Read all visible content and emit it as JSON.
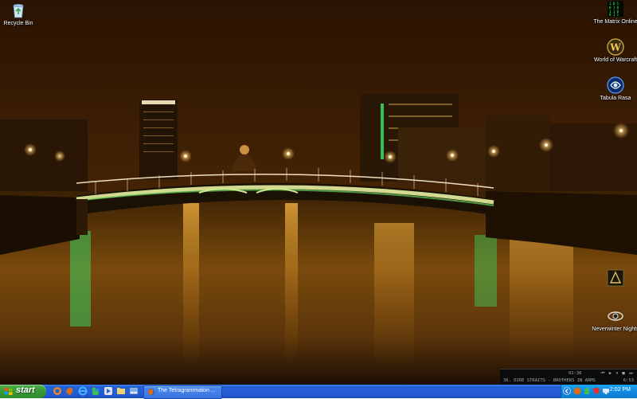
{
  "desktop_icons": [
    {
      "id": "recycle-bin",
      "label": "Recycle Bin",
      "icon": "recycle-bin-icon"
    },
    {
      "id": "matrix-online",
      "label": "The Matrix Online",
      "icon": "matrix-icon"
    },
    {
      "id": "wow",
      "label": "World of Warcraft",
      "icon": "warcraft-icon"
    },
    {
      "id": "tabula-rasa",
      "label": "Tabula Rasa",
      "icon": "tabula-rasa-icon"
    },
    {
      "id": "neverwinter",
      "label": "Neverwinter Nights",
      "icon": "neverwinter-icon"
    }
  ],
  "partial_icon": {
    "icon": "game-shortcut-icon"
  },
  "media_widget": {
    "time": "02:36",
    "controls": "⏮ ▶ ⏸ ■ ⏭",
    "track": "36. DIRE STRAITS - BROTHERS IN ARMS",
    "elapsed": "6:53"
  },
  "taskbar": {
    "start_label": "start",
    "quick_launch": [
      "browser-icon",
      "firefox-icon",
      "ie-icon",
      "messenger-icon",
      "media-icon",
      "folder-icon",
      "show-desktop-icon"
    ],
    "active_window": "The Tetragrammaton ...",
    "clock": "2:02 PM",
    "tray_icons": [
      "expand-tray-icon",
      "firefox-tray-icon",
      "messenger-tray-icon",
      "shield-tray-icon",
      "network-tray-icon",
      "volume-tray-icon"
    ]
  },
  "colors": {
    "sky": "#3a1e04",
    "glow": "#e6a020",
    "taskbar": "#245dd6",
    "start": "#3a9a36",
    "tray": "#0f8ae0"
  }
}
